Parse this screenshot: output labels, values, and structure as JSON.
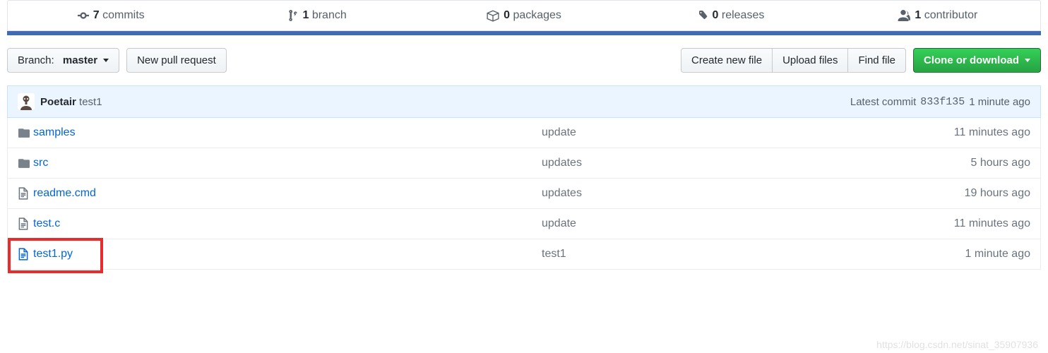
{
  "stats": {
    "commits": {
      "count": "7",
      "label": "commits"
    },
    "branches": {
      "count": "1",
      "label": "branch"
    },
    "packages": {
      "count": "0",
      "label": "packages"
    },
    "releases": {
      "count": "0",
      "label": "releases"
    },
    "contributors": {
      "count": "1",
      "label": "contributor"
    }
  },
  "toolbar": {
    "branch_prefix": "Branch:",
    "branch_name": "master",
    "new_pr": "New pull request",
    "create_file": "Create new file",
    "upload_files": "Upload files",
    "find_file": "Find file",
    "clone": "Clone or download"
  },
  "commit": {
    "author": "Poetair",
    "message": "test1",
    "latest_label": "Latest commit",
    "sha": "833f135",
    "time": "1 minute ago"
  },
  "files": [
    {
      "type": "dir",
      "name": "samples",
      "msg": "update",
      "time": "11 minutes ago"
    },
    {
      "type": "dir",
      "name": "src",
      "msg": "updates",
      "time": "5 hours ago"
    },
    {
      "type": "file",
      "name": "readme.cmd",
      "msg": "updates",
      "time": "19 hours ago"
    },
    {
      "type": "file",
      "name": "test.c",
      "msg": "update",
      "time": "11 minutes ago"
    },
    {
      "type": "file",
      "name": "test1.py",
      "msg": "test1",
      "time": "1 minute ago",
      "highlighted": true
    }
  ],
  "watermark": "https://blog.csdn.net/sinat_35907936"
}
